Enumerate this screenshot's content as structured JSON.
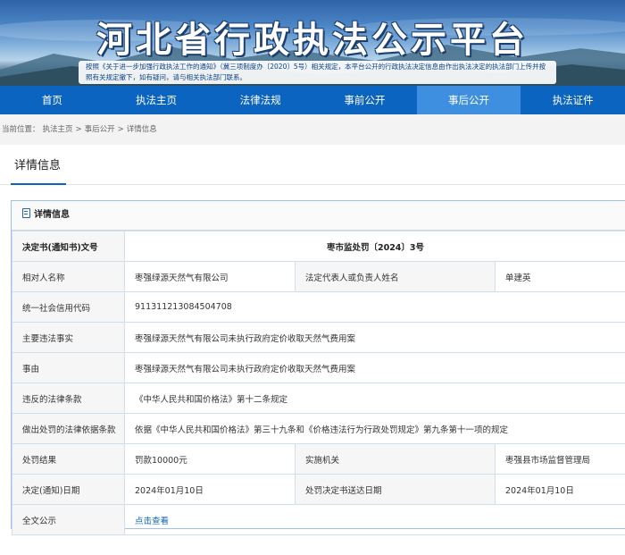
{
  "header": {
    "title": "河北省行政执法公示平台",
    "notice": "按照《关于进一步加强行政执法工作的通知》（冀三项制度办〔2020〕5号）相关规定，本平台公开的行政执法决定信息由作出执法决定的执法部门上传并按照有关规定撤下，如有疑问，请与相关执法部门联系。"
  },
  "nav": {
    "items": [
      {
        "label": "首页"
      },
      {
        "label": "执法主页"
      },
      {
        "label": "法律法规"
      },
      {
        "label": "事前公开"
      },
      {
        "label": "事后公开"
      },
      {
        "label": "执法证件"
      }
    ],
    "active_index": 4,
    "active_color": "#3f8fe0",
    "bar_color": "#0c64c1"
  },
  "breadcrumb": {
    "prefix": "当前位置：",
    "items": [
      "执法主页",
      "事后公开",
      "详情信息"
    ],
    "separator": ">"
  },
  "section": {
    "title": "详情信息"
  },
  "detail": {
    "header": "详情信息",
    "decision_no_label": "决定书(通知书)文号",
    "decision_no": "枣市监处罚〔2024〕3号",
    "party_label": "相对人名称",
    "party": "枣强绿源天然气有限公司",
    "rep_label": "法定代表人或负责人姓名",
    "rep": "单建英",
    "credit_code_label": "统一社会信用代码",
    "credit_code": "911311213084504708",
    "violation_label": "主要违法事实",
    "violation": "枣强绿源天然气有限公司未执行政府定价收取天然气费用案",
    "cause_label": "事由",
    "cause": "枣强绿源天然气有限公司未执行政府定价收取天然气费用案",
    "law_label": "违反的法律条款",
    "law": "《中华人民共和国价格法》第十二条规定",
    "basis_label": "做出处罚的法律依据条款",
    "basis": "依据《中华人民共和国价格法》第三十九条和《价格违法行为行政处罚规定》第九条第十一项的规定",
    "result_label": "处罚结果",
    "result": "罚款10000元",
    "agency_label": "实施机关",
    "agency": "枣强县市场监督管理局",
    "decision_date_label": "决定(通知)日期",
    "decision_date": "2024年01月10日",
    "delivery_label": "处罚决定书送达日期",
    "delivery_date": "2024年01月10日",
    "fulltext_label": "全文公示",
    "fulltext_link": "点击查看"
  }
}
